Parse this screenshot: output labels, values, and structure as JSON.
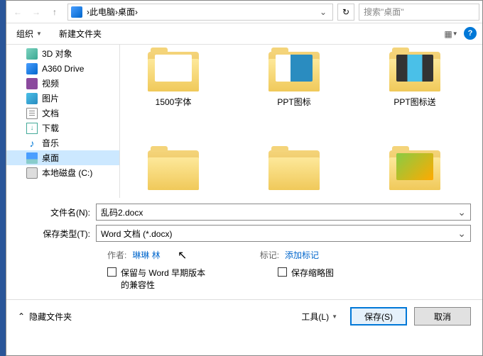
{
  "nav": {
    "path_parts": [
      "此电脑",
      "桌面"
    ],
    "search_placeholder": "搜索\"桌面\""
  },
  "toolbar": {
    "organize": "组织",
    "new_folder": "新建文件夹"
  },
  "tree": {
    "items": [
      {
        "label": "3D 对象",
        "icon": "3d"
      },
      {
        "label": "A360 Drive",
        "icon": "a360"
      },
      {
        "label": "视频",
        "icon": "video"
      },
      {
        "label": "图片",
        "icon": "pic"
      },
      {
        "label": "文档",
        "icon": "doc"
      },
      {
        "label": "下载",
        "icon": "dl"
      },
      {
        "label": "音乐",
        "icon": "music"
      },
      {
        "label": "桌面",
        "icon": "desk",
        "selected": true
      },
      {
        "label": "本地磁盘 (C:)",
        "icon": "disk"
      }
    ]
  },
  "files": {
    "items": [
      {
        "label": "1500字体",
        "content": "plain"
      },
      {
        "label": "PPT图标",
        "content": "ppt"
      },
      {
        "label": "PPT图标送",
        "content": "ppt2"
      },
      {
        "label": "",
        "content": "hidden"
      },
      {
        "label": "",
        "content": "hidden2"
      },
      {
        "label": "",
        "content": "hidden3"
      }
    ]
  },
  "form": {
    "filename_label": "文件名(N):",
    "filename_value": "乱码2.docx",
    "filetype_label": "保存类型(T):",
    "filetype_value": "Word 文档 (*.docx)"
  },
  "meta": {
    "author_label": "作者:",
    "author_value": "琳琳 林",
    "tags_label": "标记:",
    "tags_value": "添加标记"
  },
  "checks": {
    "compat": "保留与 Word 早期版本的兼容性",
    "thumb": "保存缩略图"
  },
  "footer": {
    "hide_folders": "隐藏文件夹",
    "tools": "工具(L)",
    "save": "保存(S)",
    "cancel": "取消"
  }
}
